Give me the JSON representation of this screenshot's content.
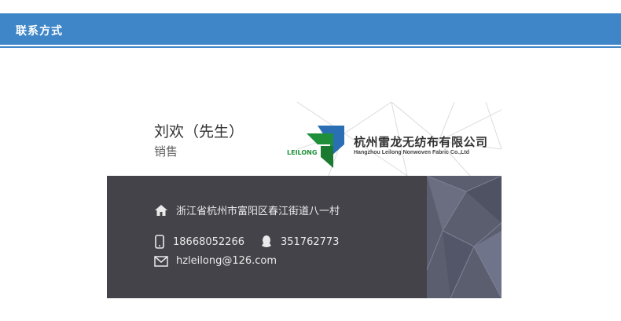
{
  "header": {
    "title": "联系方式"
  },
  "card": {
    "name": "刘欢（先生）",
    "role": "销售",
    "logo_text": "LEILONG",
    "company_cn": "杭州雷龙无纺布有限公司",
    "company_en": "Hangzhou Leilong Nonwoven Fabric Co.,Ltd",
    "address": "浙江省杭州市富阳区春江街道八一村",
    "phone": "18668052266",
    "qq": "351762773",
    "email": "hzleilong@126.com",
    "icons": [
      "home-icon",
      "phone-icon",
      "qq-icon",
      "mail-icon"
    ],
    "colors": {
      "header": "#3f86c8",
      "card_dark": "#444349",
      "logo_green": "#1f8f3a",
      "logo_blue": "#2a6fb3"
    }
  }
}
